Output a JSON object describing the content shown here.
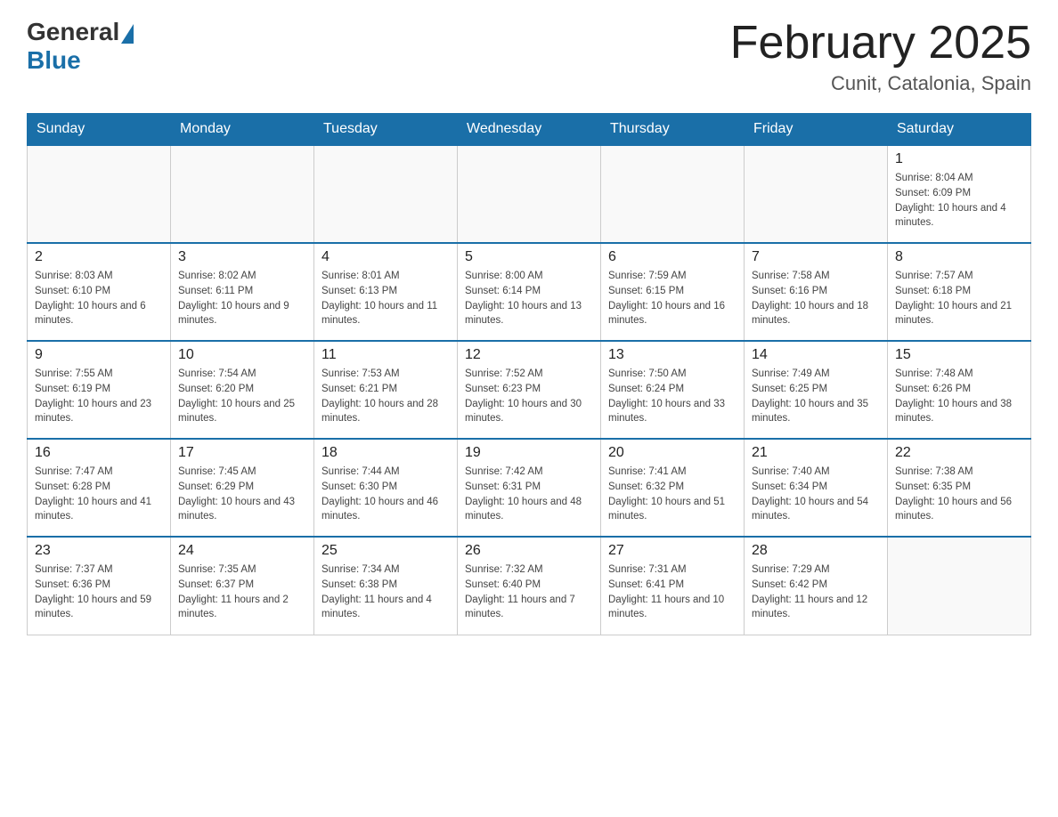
{
  "header": {
    "logo_general": "General",
    "logo_blue": "Blue",
    "month_title": "February 2025",
    "location": "Cunit, Catalonia, Spain"
  },
  "days_of_week": [
    "Sunday",
    "Monday",
    "Tuesday",
    "Wednesday",
    "Thursday",
    "Friday",
    "Saturday"
  ],
  "weeks": [
    [
      {
        "day": "",
        "info": ""
      },
      {
        "day": "",
        "info": ""
      },
      {
        "day": "",
        "info": ""
      },
      {
        "day": "",
        "info": ""
      },
      {
        "day": "",
        "info": ""
      },
      {
        "day": "",
        "info": ""
      },
      {
        "day": "1",
        "info": "Sunrise: 8:04 AM\nSunset: 6:09 PM\nDaylight: 10 hours and 4 minutes."
      }
    ],
    [
      {
        "day": "2",
        "info": "Sunrise: 8:03 AM\nSunset: 6:10 PM\nDaylight: 10 hours and 6 minutes."
      },
      {
        "day": "3",
        "info": "Sunrise: 8:02 AM\nSunset: 6:11 PM\nDaylight: 10 hours and 9 minutes."
      },
      {
        "day": "4",
        "info": "Sunrise: 8:01 AM\nSunset: 6:13 PM\nDaylight: 10 hours and 11 minutes."
      },
      {
        "day": "5",
        "info": "Sunrise: 8:00 AM\nSunset: 6:14 PM\nDaylight: 10 hours and 13 minutes."
      },
      {
        "day": "6",
        "info": "Sunrise: 7:59 AM\nSunset: 6:15 PM\nDaylight: 10 hours and 16 minutes."
      },
      {
        "day": "7",
        "info": "Sunrise: 7:58 AM\nSunset: 6:16 PM\nDaylight: 10 hours and 18 minutes."
      },
      {
        "day": "8",
        "info": "Sunrise: 7:57 AM\nSunset: 6:18 PM\nDaylight: 10 hours and 21 minutes."
      }
    ],
    [
      {
        "day": "9",
        "info": "Sunrise: 7:55 AM\nSunset: 6:19 PM\nDaylight: 10 hours and 23 minutes."
      },
      {
        "day": "10",
        "info": "Sunrise: 7:54 AM\nSunset: 6:20 PM\nDaylight: 10 hours and 25 minutes."
      },
      {
        "day": "11",
        "info": "Sunrise: 7:53 AM\nSunset: 6:21 PM\nDaylight: 10 hours and 28 minutes."
      },
      {
        "day": "12",
        "info": "Sunrise: 7:52 AM\nSunset: 6:23 PM\nDaylight: 10 hours and 30 minutes."
      },
      {
        "day": "13",
        "info": "Sunrise: 7:50 AM\nSunset: 6:24 PM\nDaylight: 10 hours and 33 minutes."
      },
      {
        "day": "14",
        "info": "Sunrise: 7:49 AM\nSunset: 6:25 PM\nDaylight: 10 hours and 35 minutes."
      },
      {
        "day": "15",
        "info": "Sunrise: 7:48 AM\nSunset: 6:26 PM\nDaylight: 10 hours and 38 minutes."
      }
    ],
    [
      {
        "day": "16",
        "info": "Sunrise: 7:47 AM\nSunset: 6:28 PM\nDaylight: 10 hours and 41 minutes."
      },
      {
        "day": "17",
        "info": "Sunrise: 7:45 AM\nSunset: 6:29 PM\nDaylight: 10 hours and 43 minutes."
      },
      {
        "day": "18",
        "info": "Sunrise: 7:44 AM\nSunset: 6:30 PM\nDaylight: 10 hours and 46 minutes."
      },
      {
        "day": "19",
        "info": "Sunrise: 7:42 AM\nSunset: 6:31 PM\nDaylight: 10 hours and 48 minutes."
      },
      {
        "day": "20",
        "info": "Sunrise: 7:41 AM\nSunset: 6:32 PM\nDaylight: 10 hours and 51 minutes."
      },
      {
        "day": "21",
        "info": "Sunrise: 7:40 AM\nSunset: 6:34 PM\nDaylight: 10 hours and 54 minutes."
      },
      {
        "day": "22",
        "info": "Sunrise: 7:38 AM\nSunset: 6:35 PM\nDaylight: 10 hours and 56 minutes."
      }
    ],
    [
      {
        "day": "23",
        "info": "Sunrise: 7:37 AM\nSunset: 6:36 PM\nDaylight: 10 hours and 59 minutes."
      },
      {
        "day": "24",
        "info": "Sunrise: 7:35 AM\nSunset: 6:37 PM\nDaylight: 11 hours and 2 minutes."
      },
      {
        "day": "25",
        "info": "Sunrise: 7:34 AM\nSunset: 6:38 PM\nDaylight: 11 hours and 4 minutes."
      },
      {
        "day": "26",
        "info": "Sunrise: 7:32 AM\nSunset: 6:40 PM\nDaylight: 11 hours and 7 minutes."
      },
      {
        "day": "27",
        "info": "Sunrise: 7:31 AM\nSunset: 6:41 PM\nDaylight: 11 hours and 10 minutes."
      },
      {
        "day": "28",
        "info": "Sunrise: 7:29 AM\nSunset: 6:42 PM\nDaylight: 11 hours and 12 minutes."
      },
      {
        "day": "",
        "info": ""
      }
    ]
  ]
}
